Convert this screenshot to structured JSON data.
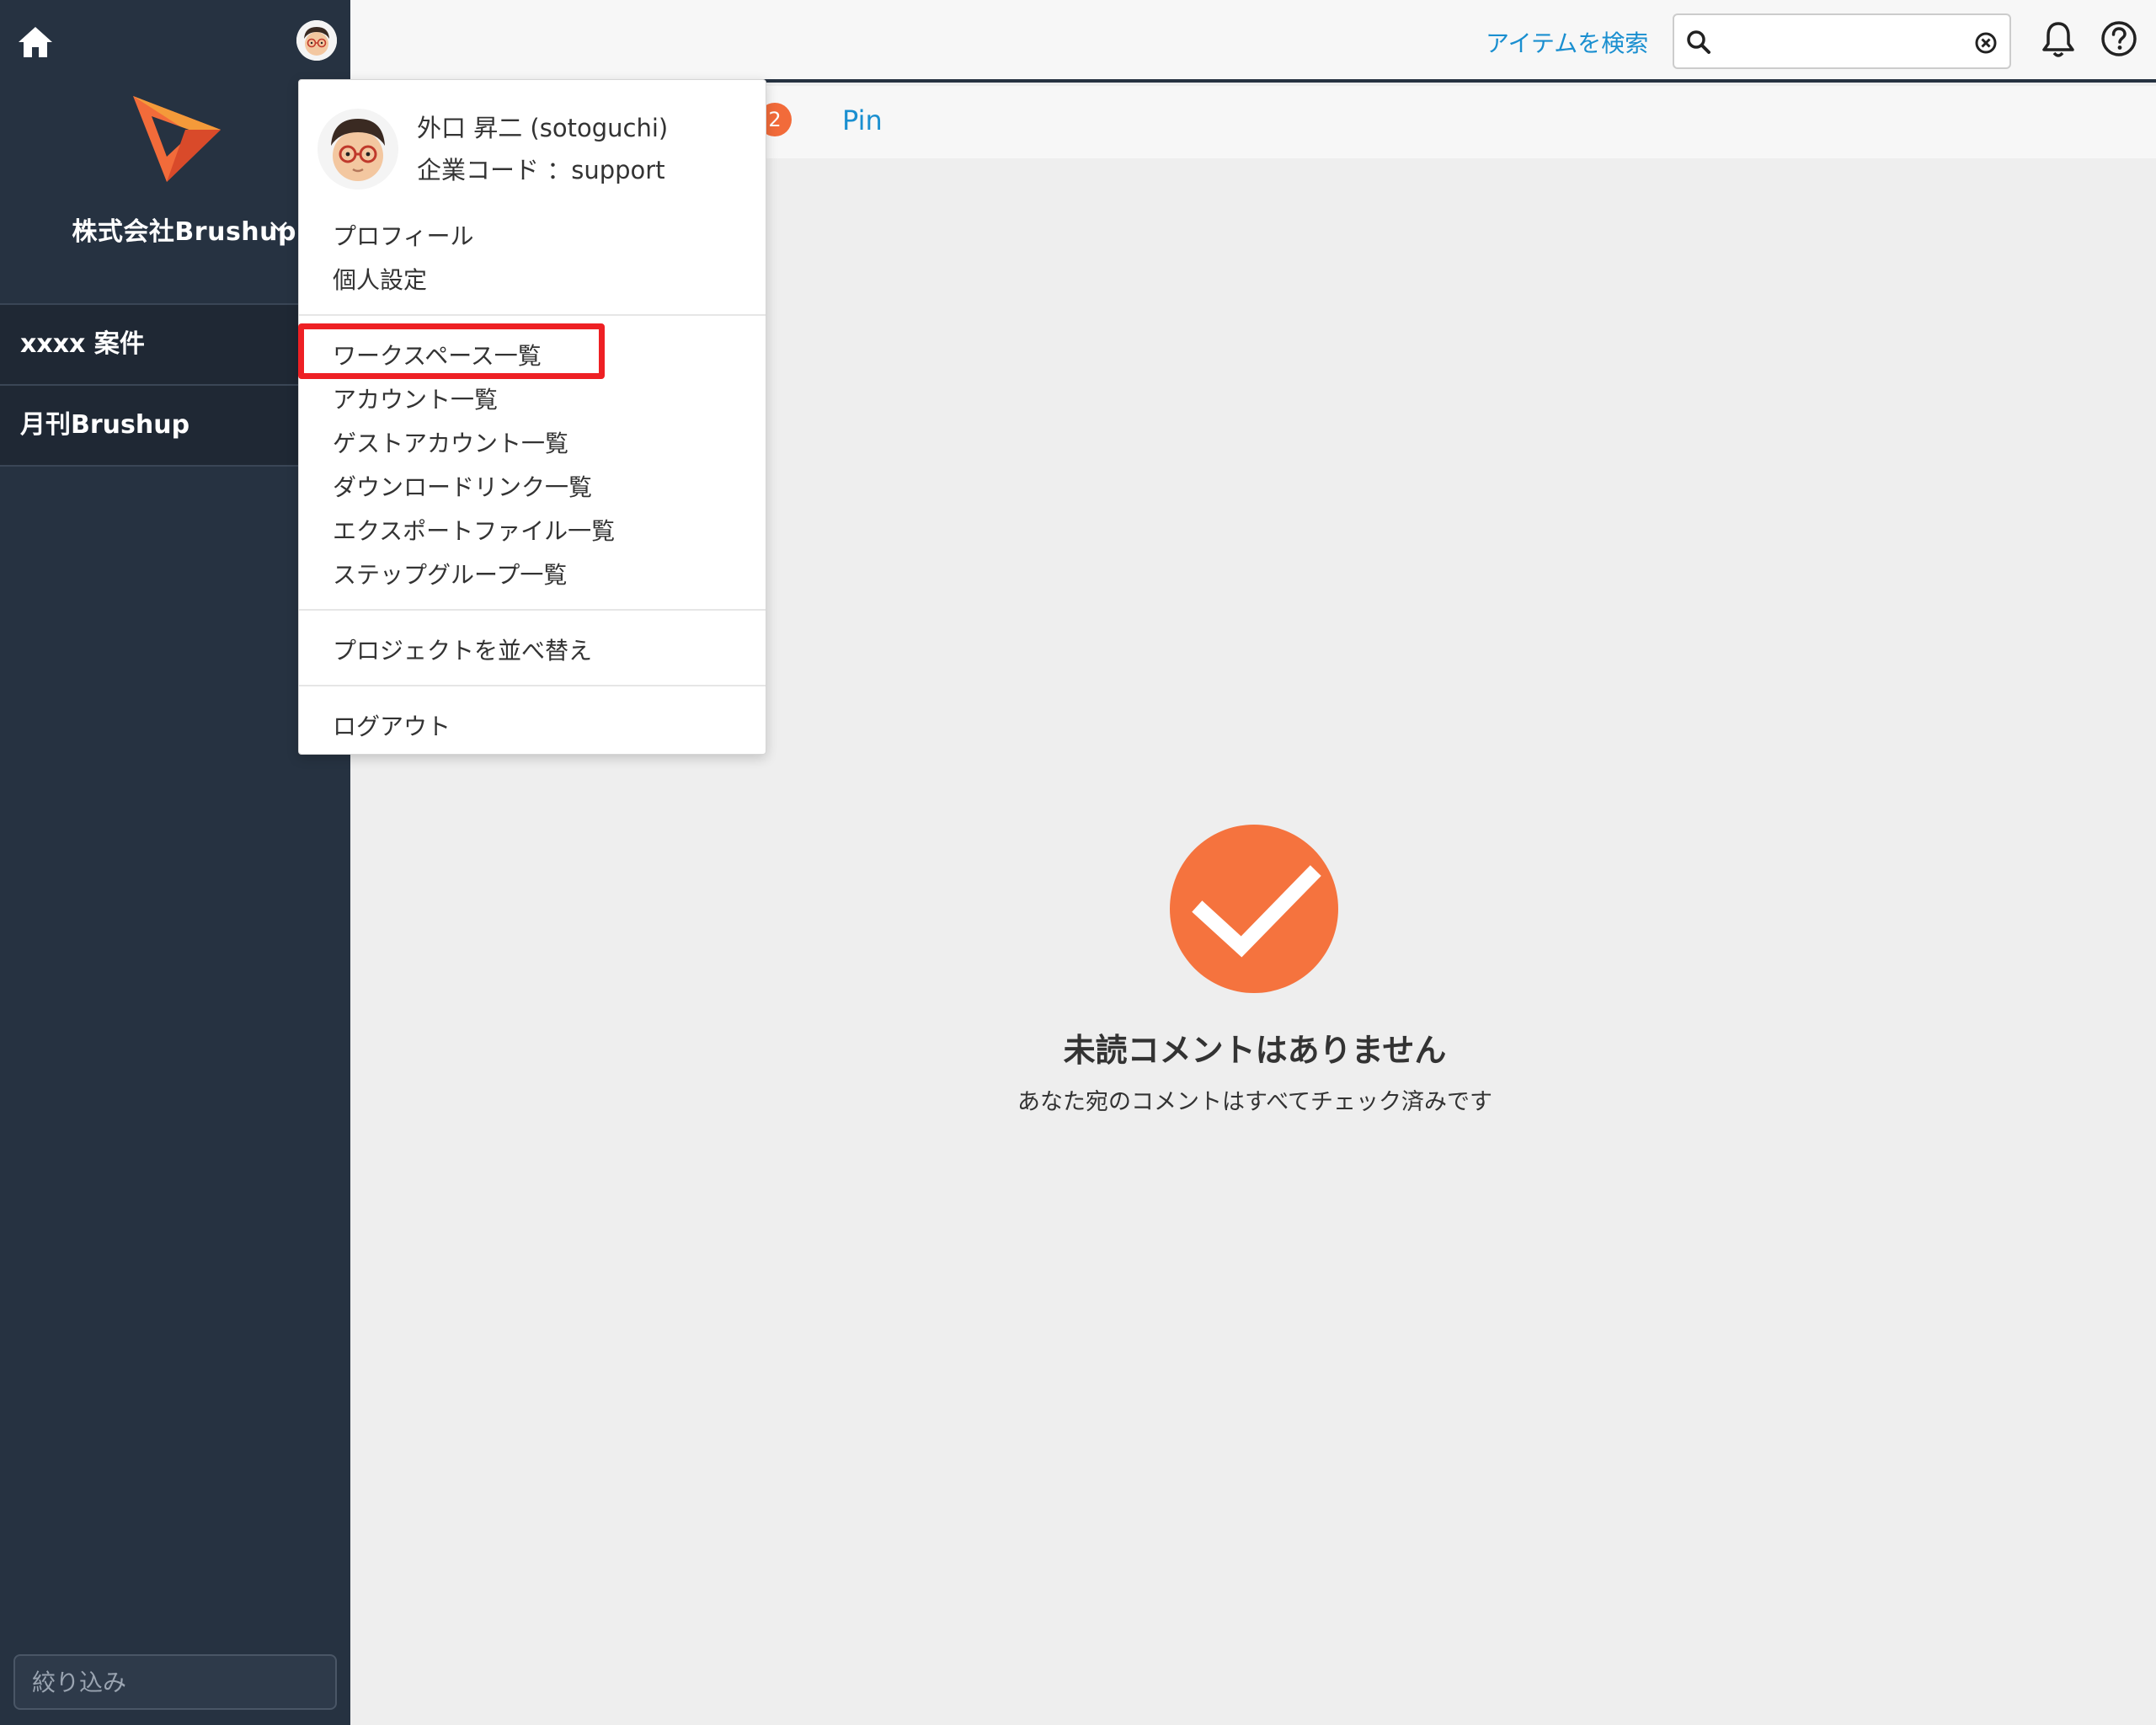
{
  "sidebar": {
    "company_name": "株式会社Brushup",
    "projects": [
      {
        "label": "xxxx 案件"
      },
      {
        "label": "月刊Brushup"
      }
    ],
    "filter_placeholder": "絞り込み"
  },
  "header": {
    "search_link": "アイテムを検索",
    "search_value": ""
  },
  "tabs": {
    "badge_count": "2",
    "pin_label": "Pin"
  },
  "empty_state": {
    "title": "未読コメントはありません",
    "subtitle": "あなた宛のコメントはすべてチェック済みです"
  },
  "user_menu": {
    "username": "外口 昇二 (sotoguchi)",
    "company_code": "企業コード ：support",
    "groups": [
      [
        "プロフィール",
        "個人設定"
      ],
      [
        "ワークスペース一覧",
        "アカウント一覧",
        "ゲストアカウント一覧",
        "ダウンロードリンク一覧",
        "エクスポートファイル一覧",
        "ステップグループ一覧"
      ],
      [
        "プロジェクトを並べ替え"
      ],
      [
        "ログアウト"
      ]
    ],
    "highlighted_item": "ワークスペース一覧"
  },
  "colors": {
    "sidebar_bg": "#263241",
    "accent_orange": "#f26b3a",
    "link_blue": "#1a8fd0",
    "highlight_red": "#ee2024"
  },
  "icons": [
    "home-icon",
    "avatar",
    "brushup-logo",
    "chevron-down-icon",
    "search-icon",
    "clear-icon",
    "bell-icon",
    "help-icon",
    "checkmark-icon"
  ]
}
